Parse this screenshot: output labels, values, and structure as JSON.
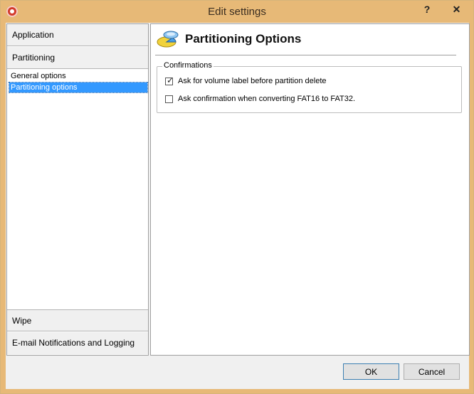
{
  "window": {
    "title": "Edit settings",
    "help_glyph": "?",
    "close_glyph": "✕",
    "icon": "app-icon"
  },
  "sidebar": {
    "sections_top": [
      {
        "label": "Application"
      },
      {
        "label": "Partitioning"
      }
    ],
    "items": [
      {
        "label": "General options",
        "selected": false
      },
      {
        "label": "Partitioning options",
        "selected": true
      }
    ],
    "sections_bottom": [
      {
        "label": "Wipe"
      },
      {
        "label": "E-mail Notifications and Logging"
      }
    ]
  },
  "panel": {
    "icon": "partition-disk-icon",
    "title": "Partitioning Options",
    "group": {
      "legend": "Confirmations",
      "options": [
        {
          "label": "Ask for volume label before partition delete",
          "checked": true,
          "check_glyph": "✓"
        },
        {
          "label": "Ask confirmation when converting FAT16 to FAT32.",
          "checked": false,
          "check_glyph": ""
        }
      ]
    }
  },
  "buttons": {
    "ok": "OK",
    "cancel": "Cancel"
  },
  "colors": {
    "title_bar": "#e7b977",
    "selection": "#3399ff"
  }
}
